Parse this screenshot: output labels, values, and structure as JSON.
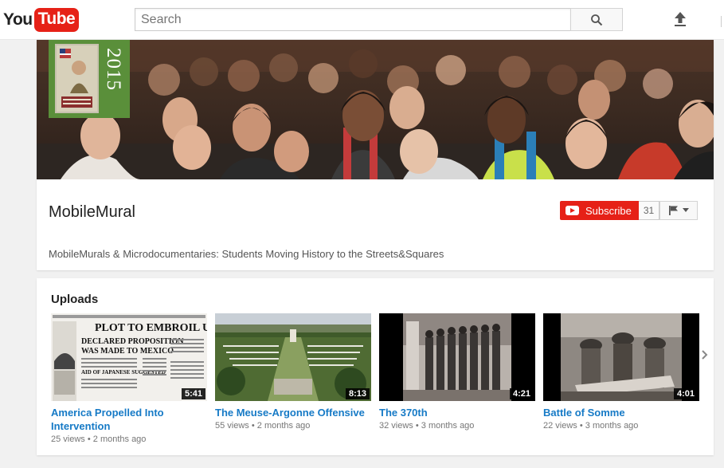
{
  "masthead": {
    "logo_you": "You",
    "logo_tube": "Tube",
    "search_placeholder": "Search",
    "icons": {
      "search": "search-icon",
      "upload": "upload-icon"
    }
  },
  "channel": {
    "name": "MobileMural",
    "banner_year": "2015",
    "subscribe_label": "Subscribe",
    "subscriber_count": "31",
    "description": "MobileMurals & Microdocumentaries: Students Moving History to the Streets&Squares",
    "colors": {
      "subscribe": "#e62117",
      "badge": "#5a8f3a"
    }
  },
  "uploads": {
    "title": "Uploads",
    "videos": [
      {
        "title_line1": "America Propelled Into",
        "title_line2": "Intervention",
        "duration": "5:41",
        "views": "25 views",
        "age": "2 months ago"
      },
      {
        "title_line1": "The Meuse-Argonne Offensive",
        "title_line2": "",
        "duration": "8:13",
        "views": "55 views",
        "age": "2 months ago"
      },
      {
        "title_line1": "The 370th",
        "title_line2": "",
        "duration": "4:21",
        "views": "32 views",
        "age": "3 months ago"
      },
      {
        "title_line1": "Battle of Somme",
        "title_line2": "",
        "duration": "4:01",
        "views": "22 views",
        "age": "3 months ago"
      }
    ],
    "thumb1_text": {
      "l1": "PLOT TO EMBROIL U.S. IN WAR",
      "l2": "DECLARED PROPOSITION",
      "l3": "WAS MADE TO MEXICO",
      "l4": "AID OF JAPANESE SUGGESTED"
    },
    "link_color": "#167ac6"
  }
}
